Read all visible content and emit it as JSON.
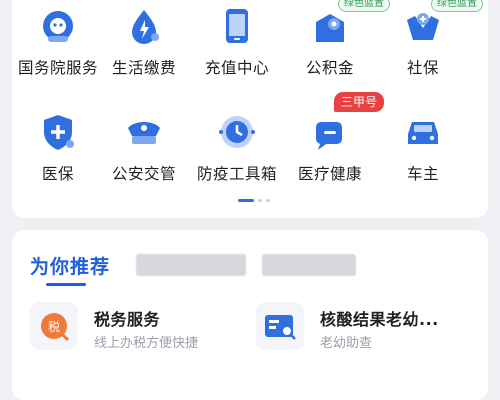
{
  "services": [
    {
      "label": "国务院服务",
      "icon": "robot-service-icon"
    },
    {
      "label": "生活缴费",
      "icon": "water-drop-bolt-icon"
    },
    {
      "label": "充值中心",
      "icon": "phone-recharge-icon"
    },
    {
      "label": "公积金",
      "icon": "housing-fund-icon",
      "badge": "绿色蓝置"
    },
    {
      "label": "社保",
      "icon": "social-security-hands-icon",
      "badge": "绿色蓝置"
    },
    {
      "label": "医保",
      "icon": "medical-insurance-shield-icon"
    },
    {
      "label": "公安交管",
      "icon": "police-cap-icon"
    },
    {
      "label": "防疫工具箱",
      "icon": "epidemic-clock-icon"
    },
    {
      "label": "医疗健康",
      "icon": "healthcare-chat-icon",
      "badge": "三甲号"
    },
    {
      "label": "车主",
      "icon": "car-icon"
    }
  ],
  "recommend": {
    "title": "为你推荐",
    "items": [
      {
        "name": "税务服务",
        "desc": "线上办税方便快捷",
        "icon": "tax-icon"
      },
      {
        "name": "核酸结果老幼...",
        "desc": "老幼助查",
        "icon": "test-result-search-icon"
      }
    ]
  },
  "colors": {
    "accent": "#1f5fd8",
    "icon_blue": "#2f6fe0",
    "badge_red": "#e84141",
    "badge_green": "#2f9a55"
  }
}
